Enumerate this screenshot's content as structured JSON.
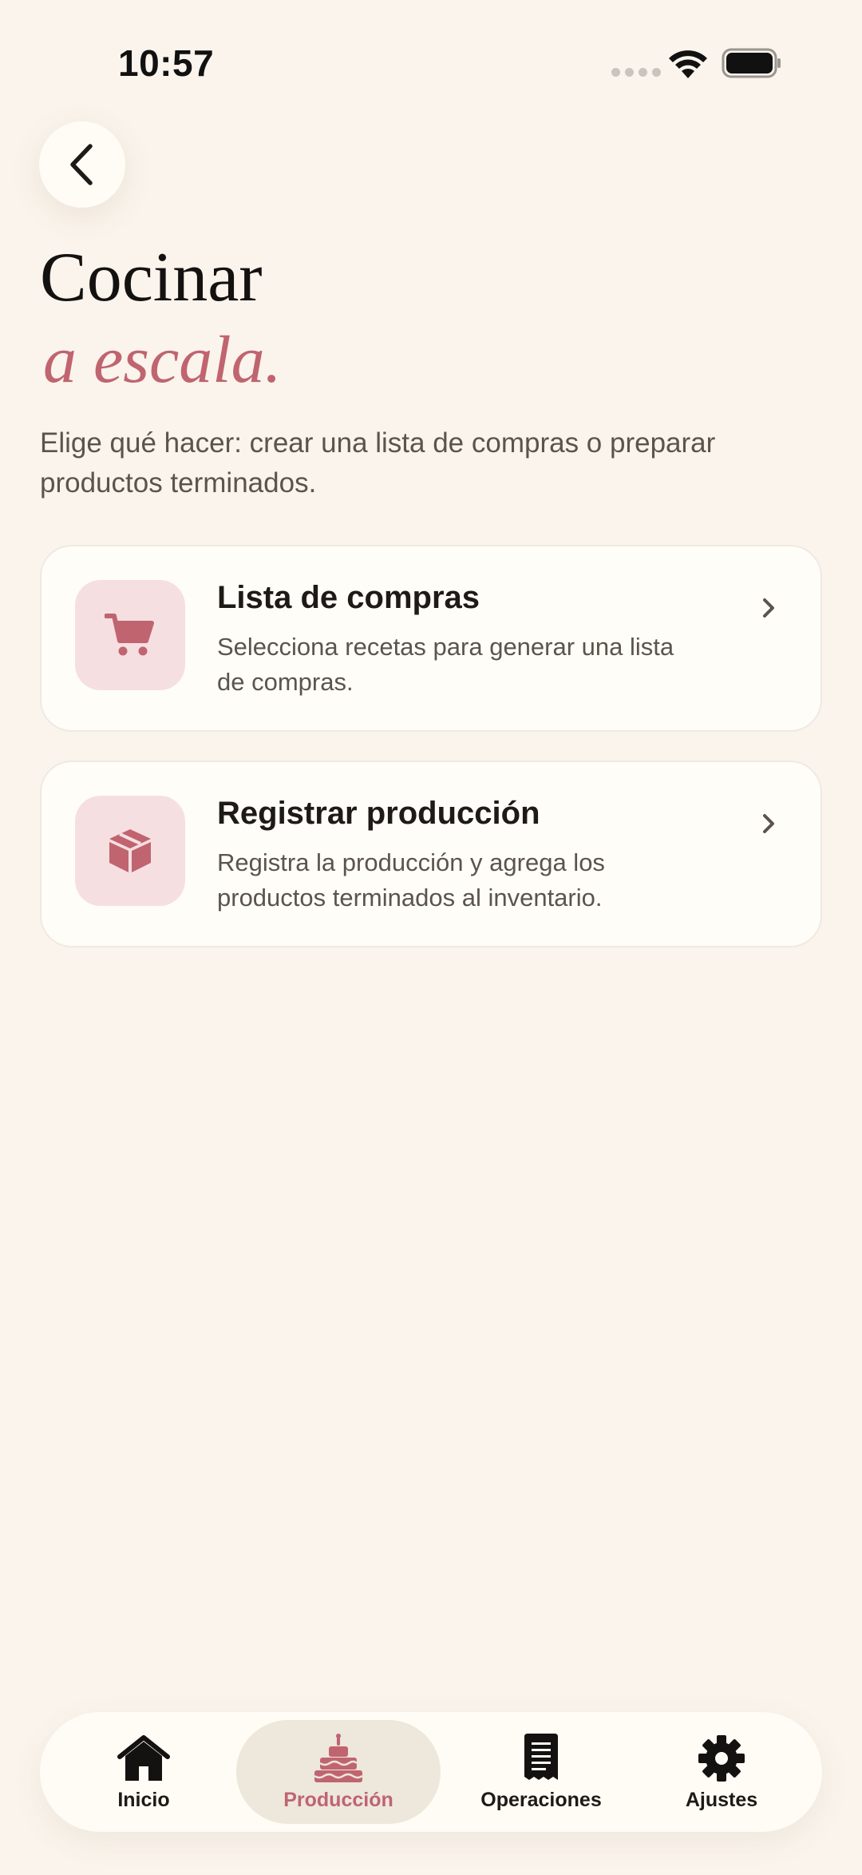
{
  "status_bar": {
    "time": "10:57"
  },
  "header": {
    "title_line1": "Cocinar",
    "title_line2": "a escala.",
    "subtitle": "Elige qué hacer: crear una lista de compras o preparar productos terminados."
  },
  "options": [
    {
      "title": "Lista de compras",
      "description": "Selecciona recetas para generar una lista de compras.",
      "icon": "cart-icon"
    },
    {
      "title": "Registrar producción",
      "description": "Registra la producción y agrega los productos terminados al inventario.",
      "icon": "box-icon"
    }
  ],
  "tab_bar": {
    "active": "Producción",
    "tabs": [
      {
        "label": "Inicio",
        "icon": "home-icon"
      },
      {
        "label": "Producción",
        "icon": "cake-icon"
      },
      {
        "label": "Operaciones",
        "icon": "receipt-icon"
      },
      {
        "label": "Ajustes",
        "icon": "gear-icon"
      }
    ]
  },
  "colors": {
    "background": "#faf4ec",
    "accent": "#c06470",
    "icon_tile": "#f6dfe1",
    "card": "#fffdf8"
  }
}
